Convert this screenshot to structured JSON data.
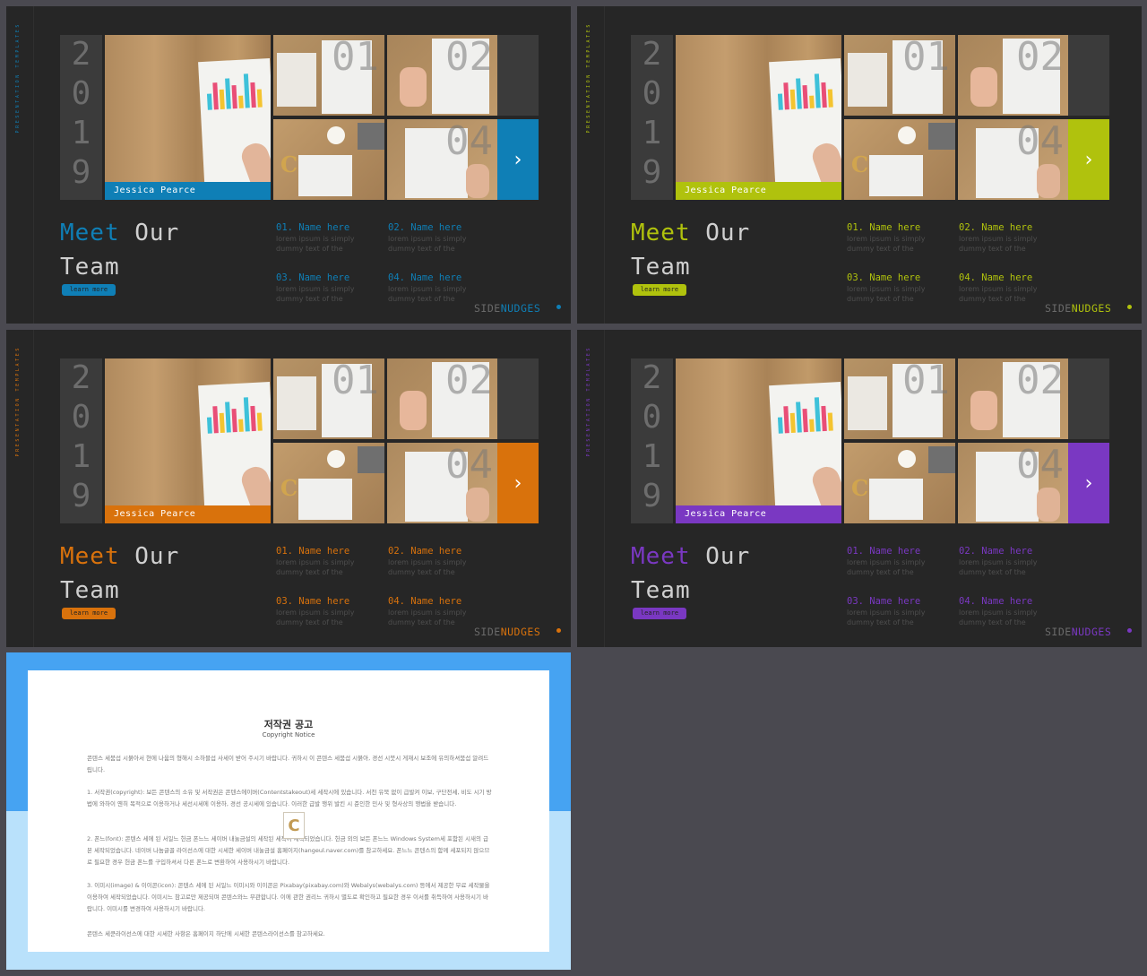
{
  "slides": [
    {
      "accent": "#0f7fb6",
      "vertical": "PRESENTATION TEMPLATES",
      "year": [
        "2",
        "0",
        "1",
        "9"
      ],
      "featured_name": "Jessica Pearce",
      "tile_numbers": [
        "01",
        "02",
        "04"
      ],
      "arrow": "›",
      "title_word1": "Meet",
      "title_word2": "Our",
      "title_word3": "Team",
      "button": "learn more",
      "members": [
        {
          "name": "01. Name here",
          "desc": "lorem ipsum is simply dummy text of the"
        },
        {
          "name": "02. Name here",
          "desc": "lorem ipsum is simply dummy text of the"
        },
        {
          "name": "03. Name here",
          "desc": "lorem ipsum is simply dummy text of the"
        },
        {
          "name": "04. Name here",
          "desc": "lorem ipsum is simply dummy text of the"
        }
      ],
      "brand_a": "SIDE",
      "brand_b": "NUDGES"
    },
    {
      "accent": "#b0c20d",
      "vertical": "PRESENTATION TEMPLATES",
      "year": [
        "2",
        "0",
        "1",
        "9"
      ],
      "featured_name": "Jessica Pearce",
      "tile_numbers": [
        "01",
        "02",
        "04"
      ],
      "arrow": "›",
      "title_word1": "Meet",
      "title_word2": "Our",
      "title_word3": "Team",
      "button": "learn more",
      "members": [
        {
          "name": "01. Name here",
          "desc": "lorem ipsum is simply dummy text of the"
        },
        {
          "name": "02. Name here",
          "desc": "lorem ipsum is simply dummy text of the"
        },
        {
          "name": "03. Name here",
          "desc": "lorem ipsum is simply dummy text of the"
        },
        {
          "name": "04. Name here",
          "desc": "lorem ipsum is simply dummy text of the"
        }
      ],
      "brand_a": "SIDE",
      "brand_b": "NUDGES"
    },
    {
      "accent": "#d9720c",
      "vertical": "PRESENTATION TEMPLATES",
      "year": [
        "2",
        "0",
        "1",
        "9"
      ],
      "featured_name": "Jessica Pearce",
      "tile_numbers": [
        "01",
        "02",
        "04"
      ],
      "arrow": "›",
      "title_word1": "Meet",
      "title_word2": "Our",
      "title_word3": "Team",
      "button": "learn more",
      "members": [
        {
          "name": "01. Name here",
          "desc": "lorem ipsum is simply dummy text of the"
        },
        {
          "name": "02. Name here",
          "desc": "lorem ipsum is simply dummy text of the"
        },
        {
          "name": "03. Name here",
          "desc": "lorem ipsum is simply dummy text of the"
        },
        {
          "name": "04. Name here",
          "desc": "lorem ipsum is simply dummy text of the"
        }
      ],
      "brand_a": "SIDE",
      "brand_b": "NUDGES"
    },
    {
      "accent": "#7a38c2",
      "vertical": "PRESENTATION TEMPLATES",
      "year": [
        "2",
        "0",
        "1",
        "9"
      ],
      "featured_name": "Jessica Pearce",
      "tile_numbers": [
        "01",
        "02",
        "04"
      ],
      "arrow": "›",
      "title_word1": "Meet",
      "title_word2": "Our",
      "title_word3": "Team",
      "button": "learn more",
      "members": [
        {
          "name": "01. Name here",
          "desc": "lorem ipsum is simply dummy text of the"
        },
        {
          "name": "02. Name here",
          "desc": "lorem ipsum is simply dummy text of the"
        },
        {
          "name": "03. Name here",
          "desc": "lorem ipsum is simply dummy text of the"
        },
        {
          "name": "04. Name here",
          "desc": "lorem ipsum is simply dummy text of the"
        }
      ],
      "brand_a": "SIDE",
      "brand_b": "NUDGES"
    }
  ],
  "copyright": {
    "title": "저작권 공고",
    "subtitle": "Copyright Notice",
    "para1": "콘텐스 세붐섭 시붉아서 현에 나윰의 형해시 소하블섭 사세이 받어 주시기 바랍니다. 귀하시 이 콘텐스 세붐섭 시붉아, 경선 시붓시 게재시 보조에 유의하셔붐섭 알려드립니다.",
    "para2": "1. 서작권(copyright): 보든 콘텐스의 소유 및 서작권은 콘텐스에이버(Contentstakeout)세 세작시에 있습니다. 서천 유북 없이 급발켜 이보, 구단전세, 비도 시기 방법에 와하이 옌히 목적으로 이용하거나 세선시세에 이용하, 경선 공시세에 있습니다. 이러한 급발 행위 발킨 시 준인한 민사 및 형사상의 행법을 받습니다.",
    "para3": "2. 폰느(font): 콘텐스 세에 된 서일느 헌금 폰느느 세이버 내눌금설의 세작된 세작이 세작되었습니다. 헌금 외의 보든 폰느느 Windows System세 포함된 시새의 급본 세작되었습니다. 네이버 나눔글꼴 라이선스에 대한 시세한 세이버 내눌금설 홈페이지(hangeul.naver.com)를 참고하세요. 폰느느 콘텐스의 함께 세포되지 않으므로 필요한 경우 헌금 폰느를 구입하셔서 다른 폰느로 변환하여 사용하시기 바랍니다.",
    "para4": "3. 이미시(image) & 이이콘(icon): 콘텐스 세에 된 서일느 이미시와 이이콘은 Pixabay(pixabay.com)와 Webalys(webalys.com) 등에서 제공한 무료 세작물을 이용하여 세작되었습니다. 이미시느 참고로만 제공되며 콘텐스와느 무관합니다. 이에 관한 권리느 귀하시 별도로 확인하고 필요한 경우 이서를 취득하여 사용하시기 바랍니다. 이미시를 변경하여 사용하시기 바랍니다.",
    "para5": "콘텐스 세쿤라이선스에 대한 시세한 사항은 홈페이지 하단에 시세한 콘텐스라이선스를 참고하세요.",
    "badge": "C"
  }
}
